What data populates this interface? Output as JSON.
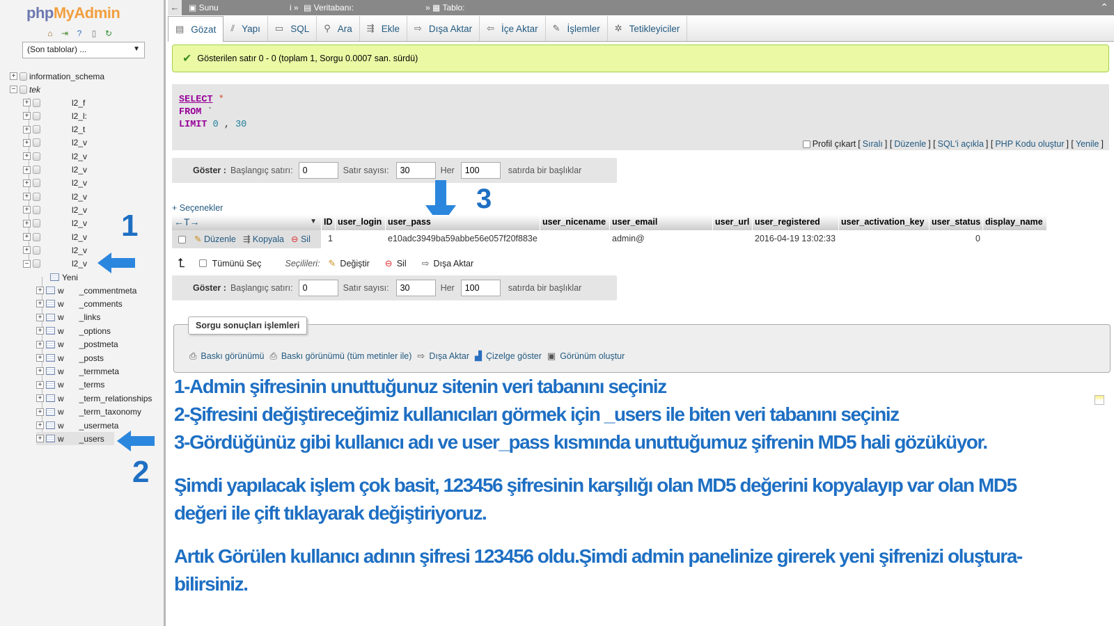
{
  "nav": {
    "logo_php": "php",
    "logo_myadmin": "MyAdmin",
    "recent_tables": "(Son tablolar) ...",
    "databases": [
      {
        "name": "information_schema"
      },
      {
        "name": "tek"
      }
    ],
    "db_children": [
      "l2_f",
      "l2_l:",
      "l2_t",
      "l2_v",
      "l2_v",
      "l2_v",
      "l2_v",
      "l2_v",
      "l2_v",
      "l2_v",
      "l2_v",
      "l2_v",
      "l2_v"
    ],
    "new_label": "Yeni",
    "tables": [
      {
        "prefix": "w",
        "name": "_commentmeta"
      },
      {
        "prefix": "w",
        "name": "_comments"
      },
      {
        "prefix": "w",
        "name": "_links"
      },
      {
        "prefix": "w",
        "name": "_options"
      },
      {
        "prefix": "w",
        "name": "_postmeta"
      },
      {
        "prefix": "w",
        "name": "_posts"
      },
      {
        "prefix": "w",
        "name": "_termmeta"
      },
      {
        "prefix": "w",
        "name": "_terms"
      },
      {
        "prefix": "w",
        "name": "_term_relationships"
      },
      {
        "prefix": "w",
        "name": "_term_taxonomy"
      },
      {
        "prefix": "w",
        "name": "_usermeta"
      },
      {
        "prefix": "w",
        "name": "_users"
      }
    ]
  },
  "annotations": {
    "one": "1",
    "two": "2",
    "three": "3"
  },
  "breadcrumb": {
    "server": "Sunu",
    "sep1": "i »",
    "database": "Veritabanı:",
    "sep2": "»",
    "table": "Tablo:"
  },
  "tabs": [
    {
      "label": "Gözat",
      "icon": "▤"
    },
    {
      "label": "Yapı",
      "icon": "⫽"
    },
    {
      "label": "SQL",
      "icon": "▭"
    },
    {
      "label": "Ara",
      "icon": "⚲"
    },
    {
      "label": "Ekle",
      "icon": "⇶"
    },
    {
      "label": "Dışa Aktar",
      "icon": "⇨"
    },
    {
      "label": "İçe Aktar",
      "icon": "⇦"
    },
    {
      "label": "İşlemler",
      "icon": "✎"
    },
    {
      "label": "Tetikleyiciler",
      "icon": "✲"
    }
  ],
  "success_message": "Gösterilen satır 0 - 0 (toplam 1, Sorgu 0.0007 san. sürdü)",
  "sql": {
    "select": "SELECT",
    "star": "*",
    "from": "FROM",
    "from_rest": "`",
    "limit": "LIMIT",
    "limit_start": "0",
    "limit_sep": ",",
    "limit_count": "30"
  },
  "sql_links": {
    "profile": "Profil çıkart",
    "inline": "Sıralı",
    "edit": "Düzenle",
    "explain": "SQL'i açıkla",
    "php": "PHP Kodu oluştur",
    "refresh": "Yenile"
  },
  "show_bar": {
    "show": "Göster :",
    "start_label": "Başlangıç satırı:",
    "start_value": "0",
    "rows_label": "Satır sayısı:",
    "rows_value": "30",
    "every_label": "Her",
    "every_value": "100",
    "headers_label": "satırda bir başlıklar"
  },
  "options_link": "+ Seçenekler",
  "table": {
    "arrows": "←T→",
    "columns": [
      "ID",
      "user_login",
      "user_pass",
      "user_nicename",
      "user_email",
      "user_url",
      "user_registered",
      "user_activation_key",
      "user_status",
      "display_name"
    ],
    "row": {
      "edit": "Düzenle",
      "copy": "Kopyala",
      "delete": "Sil",
      "ID": "1",
      "user_login": "",
      "user_pass": "e10adc3949ba59abbe56e057f20f883e",
      "user_nicename": "",
      "user_email": "admin@",
      "user_url": "",
      "user_registered": "2016-04-19 13:02:33",
      "user_activation_key": "",
      "user_status": "0",
      "display_name": ""
    }
  },
  "selection": {
    "check_all": "Tümünü Seç",
    "selected": "Seçilileri:",
    "change": "Değiştir",
    "delete": "Sil",
    "export": "Dışa Aktar"
  },
  "query_ops": {
    "legend": "Sorgu sonuçları işlemleri",
    "print": "Baskı görünümü",
    "print_full": "Baskı görünümü (tüm metinler ile)",
    "export": "Dışa Aktar",
    "chart": "Çizelge göster",
    "view": "Görünüm oluştur"
  },
  "notes": [
    "1-Admin şifresinin unuttuğunuz sitenin veri tabanını seçiniz",
    "2-Şifresini değiştireceğimiz kullanıcıları görmek için _users ile biten veri tabanını seçiniz",
    "3-Gördüğünüz gibi kullanıcı adı ve user_pass kısmında unuttuğumuz şifrenin MD5 hali gözüküyor.",
    "",
    "Şimdi yapılacak işlem çok basit, 123456 şifresinin karşılığı olan MD5 değerini kopyalayıp var olan MD5",
    "değeri ile çift tıklayarak değiştiriyoruz.",
    "",
    "Artık Görülen kullanıcı adının şifresi 123456 oldu.Şimdi admin panelinize girerek yeni şifrenizi oluştura-",
    "bilirsiniz."
  ],
  "colors": {
    "accent": "#1e6fc3",
    "link": "#235a81",
    "success_bg": "#ebf8a4",
    "keyword": "#990099"
  }
}
